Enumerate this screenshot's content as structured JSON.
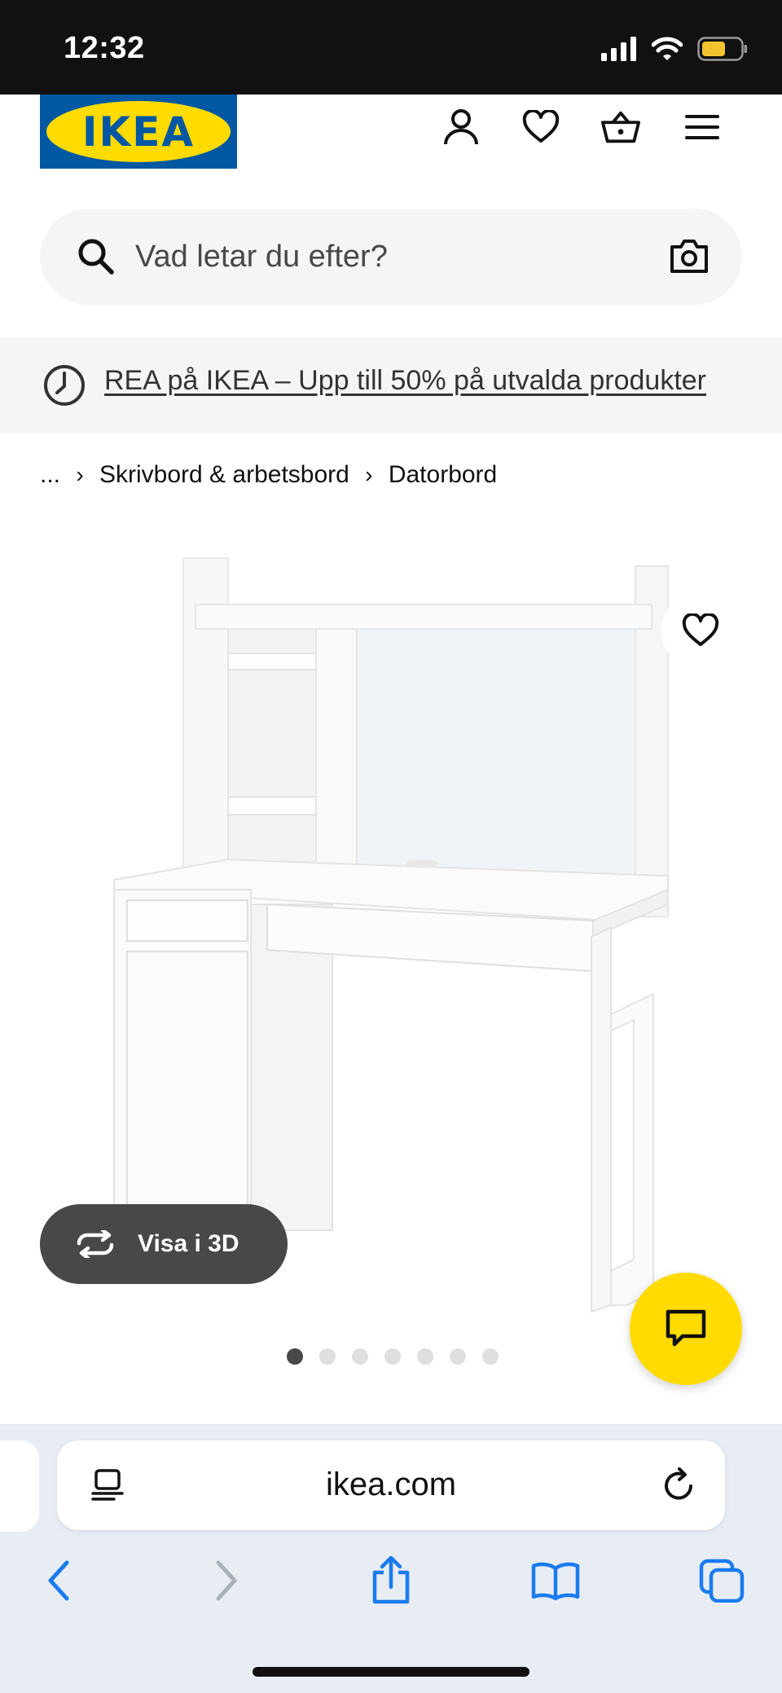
{
  "status_bar": {
    "time": "12:32"
  },
  "header": {
    "logo_text": "IKEA"
  },
  "search": {
    "placeholder": "Vad letar du efter?"
  },
  "promo": {
    "text": "REA på IKEA – Upp till 50% på utvalda produkter"
  },
  "breadcrumb": {
    "items": [
      "...",
      "Skrivbord & arbetsbord",
      "Datorbord"
    ]
  },
  "product": {
    "view_3d_label": "Visa i 3D",
    "image_count": 7,
    "active_image": 1
  },
  "browser": {
    "url": "ikea.com"
  },
  "colors": {
    "ikea_blue": "#0058a3",
    "ikea_yellow": "#ffdb00",
    "safari_blue": "#1a7bef",
    "dark_gray": "#484848"
  }
}
